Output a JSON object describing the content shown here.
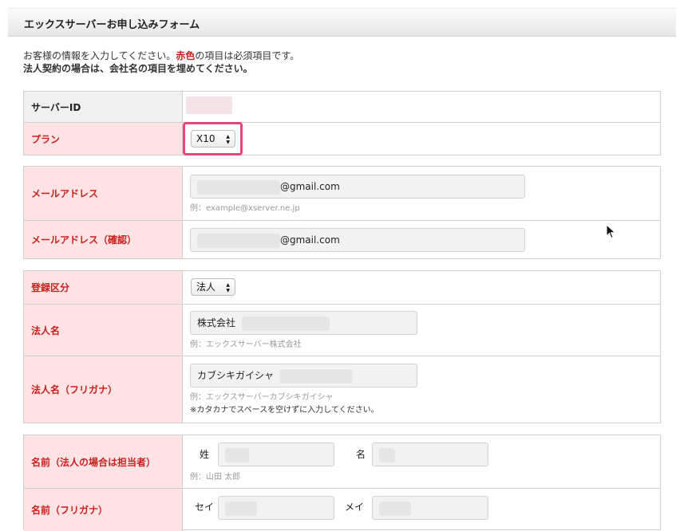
{
  "form": {
    "title": "エックスサーバーお申し込みフォーム",
    "intro_part1": "お客様の情報を入力してください。",
    "intro_required": "赤色",
    "intro_part2": "の項目は必須項目です。",
    "intro_line2": "法人契約の場合は、会社名の項目を埋めてください。"
  },
  "server": {
    "id_label": "サーバーID",
    "plan_label": "プラン",
    "plan_value": "X10"
  },
  "email": {
    "label": "メールアドレス",
    "value_suffix": "@gmail.com",
    "hint": "例：example@xserver.ne.jp",
    "confirm_label": "メールアドレス（確認）",
    "confirm_suffix": "@gmail.com"
  },
  "registration": {
    "type_label": "登録区分",
    "type_value": "法人",
    "corp_name_label": "法人名",
    "corp_name_value": "株式会社",
    "corp_name_hint": "例：エックスサーバー株式会社",
    "corp_kana_label": "法人名（フリガナ）",
    "corp_kana_value": "カブシキガイシャ",
    "corp_kana_hint": "例：エックスサーバーカブシキガイシャ",
    "corp_kana_note": "※カタカナでスペースを空けずに入力してください。"
  },
  "person": {
    "name_label": "名前（法人の場合は担当者）",
    "sei_label": "姓",
    "mei_label": "名",
    "name_hint": "例：山田 太郎",
    "kana_label": "名前（フリガナ）",
    "sei_kana_label": "セイ",
    "mei_kana_label": "メイ"
  },
  "colors": {
    "required_bg": "#fde3e3",
    "required_text": "#cc1f1f",
    "highlight": "#e8457a"
  }
}
